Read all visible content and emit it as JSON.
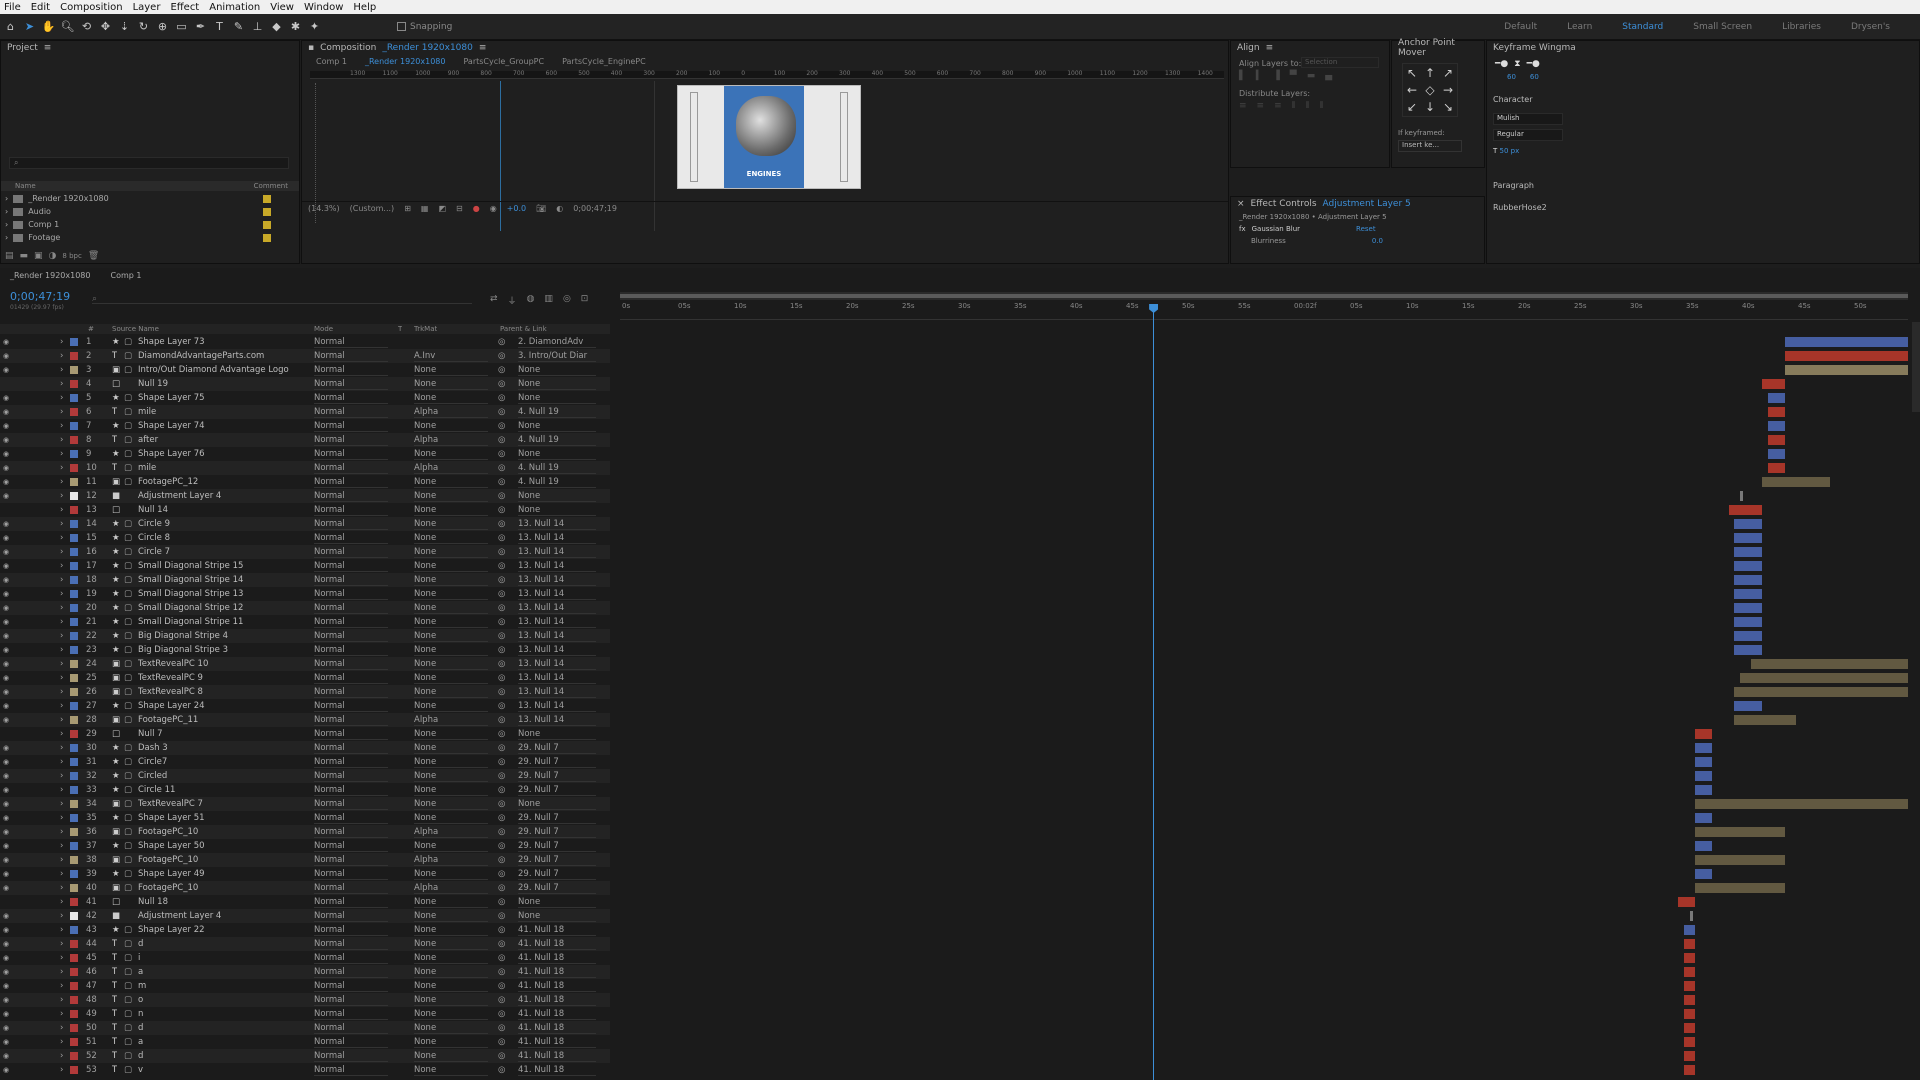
{
  "colors": {
    "accent": "#3d8fd8",
    "red": "#c0392b",
    "blueBar": "#4d6ab8",
    "tanBar": "#9a8c66",
    "tan2": "#6f6448",
    "swatchRed": "#b23a3a",
    "swatchBlue": "#4a6fb5",
    "swatchTan": "#a89a73",
    "swatchWhite": "#e8e8e8",
    "swatchGray": "#8a8a8a"
  },
  "menu": [
    "File",
    "Edit",
    "Composition",
    "Layer",
    "Effect",
    "Animation",
    "View",
    "Window",
    "Help"
  ],
  "toolbar": {
    "snapping": "Snapping",
    "workspaces": [
      "Default",
      "Learn",
      "Standard",
      "Small Screen",
      "Libraries",
      "Drysen's"
    ]
  },
  "project": {
    "title": "Project",
    "col_name": "Name",
    "col_comment": "Comment",
    "items": [
      "_Render 1920x1080",
      "Audio",
      "Comp 1",
      "Footage"
    ],
    "bpc": "8 bpc"
  },
  "composition": {
    "title": "Composition",
    "name": "_Render 1920x1080",
    "tabs": [
      "Comp 1",
      "_Render 1920x1080",
      "PartsCycle_GroupPC",
      "PartsCycle_EnginePC"
    ],
    "zoom": "(14.3%)",
    "res": "(Custom...)",
    "exposure": "+0.0",
    "time": "0;00;47;19",
    "ruler": [
      "1300",
      "1100",
      "1000",
      "900",
      "800",
      "700",
      "600",
      "500",
      "400",
      "300",
      "200",
      "100",
      "0",
      "100",
      "200",
      "300",
      "400",
      "500",
      "600",
      "700",
      "800",
      "900",
      "1000",
      "1100",
      "1200",
      "1300",
      "1400",
      "1500"
    ],
    "preview_text": "ENGINES"
  },
  "align": {
    "title": "Align",
    "align_to": "Align Layers to:",
    "align_to_value": "Selection",
    "distribute": "Distribute Layers:"
  },
  "anchor": {
    "title": "Anchor Point Mover",
    "if_keyframed": "If keyframed:",
    "insert": "Insert ke..."
  },
  "effects": {
    "title": "Effect Controls",
    "layer": "Adjustment Layer 5",
    "path": "_Render 1920x1080 • Adjustment Layer 5",
    "fx": "Gaussian Blur",
    "reset": "Reset",
    "param": "Blurriness",
    "param_val": "0.0"
  },
  "keyframe": {
    "title": "Keyframe Wingma",
    "v1": "60",
    "v2": "60",
    "character": "Character",
    "font": "Mulish",
    "style": "Regular",
    "size": "50 px",
    "paragraph": "Paragraph",
    "rubberhose": "RubberHose2"
  },
  "timeline": {
    "tabs": [
      "_Render 1920x1080",
      "Comp 1"
    ],
    "timecode": "0;00;47;19",
    "frames": "01429 (29.97 fps)",
    "cols": [
      "#",
      "Source Name",
      "Mode",
      "T",
      "TrkMat",
      "Parent & Link"
    ],
    "ticks": [
      "0s",
      "05s",
      "10s",
      "15s",
      "20s",
      "25s",
      "30s",
      "35s",
      "40s",
      "45s",
      "50s",
      "55s",
      "00:02f",
      "05s",
      "10s",
      "15s",
      "20s",
      "25s",
      "30s",
      "35s",
      "40s",
      "45s",
      "50s"
    ],
    "playhead": 47.6,
    "duration": 115
  },
  "layers": [
    {
      "n": "1",
      "name": "Shape Layer 73",
      "t": "star",
      "c": "swatchBlue",
      "mode": "Normal",
      "trk": "",
      "par": "2. DiamondAdv",
      "eye": 1,
      "s": 104,
      "e": 115,
      "bc": "blueBar"
    },
    {
      "n": "2",
      "name": "DiamondAdvantageParts.com",
      "t": "text",
      "c": "swatchRed",
      "mode": "Normal",
      "trk": "A.Inv",
      "par": "3. Intro/Out Diar",
      "eye": 1,
      "s": 104,
      "e": 115,
      "bc": "red"
    },
    {
      "n": "3",
      "name": "Intro/Out Diamond Advantage Logo",
      "t": "comp",
      "c": "swatchTan",
      "mode": "Normal",
      "trk": "None",
      "par": "None",
      "eye": 1,
      "s": 104,
      "e": 115,
      "bc": "tanBar"
    },
    {
      "n": "4",
      "name": "Null 19",
      "t": "null",
      "c": "swatchRed",
      "mode": "Normal",
      "trk": "None",
      "par": "None",
      "eye": 0,
      "s": 102,
      "e": 104,
      "bc": "red"
    },
    {
      "n": "5",
      "name": "Shape Layer 75",
      "t": "star",
      "c": "swatchBlue",
      "mode": "Normal",
      "trk": "None",
      "par": "None",
      "eye": 1,
      "s": 102.5,
      "e": 104,
      "bc": "blueBar"
    },
    {
      "n": "6",
      "name": "mile",
      "t": "text",
      "c": "swatchRed",
      "mode": "Normal",
      "trk": "Alpha",
      "par": "4. Null 19",
      "eye": 1,
      "s": 102.5,
      "e": 104,
      "bc": "red"
    },
    {
      "n": "7",
      "name": "Shape Layer 74",
      "t": "star",
      "c": "swatchBlue",
      "mode": "Normal",
      "trk": "None",
      "par": "None",
      "eye": 1,
      "s": 102.5,
      "e": 104,
      "bc": "blueBar"
    },
    {
      "n": "8",
      "name": "after",
      "t": "text",
      "c": "swatchRed",
      "mode": "Normal",
      "trk": "Alpha",
      "par": "4. Null 19",
      "eye": 1,
      "s": 102.5,
      "e": 104,
      "bc": "red"
    },
    {
      "n": "9",
      "name": "Shape Layer 76",
      "t": "star",
      "c": "swatchBlue",
      "mode": "Normal",
      "trk": "None",
      "par": "None",
      "eye": 1,
      "s": 102.5,
      "e": 104,
      "bc": "blueBar"
    },
    {
      "n": "10",
      "name": "mile",
      "t": "text",
      "c": "swatchRed",
      "mode": "Normal",
      "trk": "Alpha",
      "par": "4. Null 19",
      "eye": 1,
      "s": 102.5,
      "e": 104,
      "bc": "red"
    },
    {
      "n": "11",
      "name": "FootagePC_12",
      "t": "comp",
      "c": "swatchTan",
      "mode": "Normal",
      "trk": "None",
      "par": "4. Null 19",
      "eye": 1,
      "s": 102,
      "e": 108,
      "bc": "tan2"
    },
    {
      "n": "12",
      "name": "Adjustment Layer 4",
      "t": "adj",
      "c": "swatchWhite",
      "mode": "Normal",
      "trk": "None",
      "par": "None",
      "eye": 1,
      "s": 100,
      "e": 100.3,
      "bc": "swatchGray"
    },
    {
      "n": "13",
      "name": "Null 14",
      "t": "null",
      "c": "swatchRed",
      "mode": "Normal",
      "trk": "None",
      "par": "None",
      "eye": 0,
      "s": 99,
      "e": 102,
      "bc": "red"
    },
    {
      "n": "14",
      "name": "Circle 9",
      "t": "star",
      "c": "swatchBlue",
      "mode": "Normal",
      "trk": "None",
      "par": "13. Null 14",
      "eye": 1,
      "s": 99.5,
      "e": 102,
      "bc": "blueBar"
    },
    {
      "n": "15",
      "name": "Circle 8",
      "t": "star",
      "c": "swatchBlue",
      "mode": "Normal",
      "trk": "None",
      "par": "13. Null 14",
      "eye": 1,
      "s": 99.5,
      "e": 102,
      "bc": "blueBar"
    },
    {
      "n": "16",
      "name": "Circle 7",
      "t": "star",
      "c": "swatchBlue",
      "mode": "Normal",
      "trk": "None",
      "par": "13. Null 14",
      "eye": 1,
      "s": 99.5,
      "e": 102,
      "bc": "blueBar"
    },
    {
      "n": "17",
      "name": "Small Diagonal Stripe 15",
      "t": "star",
      "c": "swatchBlue",
      "mode": "Normal",
      "trk": "None",
      "par": "13. Null 14",
      "eye": 1,
      "s": 99.5,
      "e": 102,
      "bc": "blueBar"
    },
    {
      "n": "18",
      "name": "Small Diagonal Stripe 14",
      "t": "star",
      "c": "swatchBlue",
      "mode": "Normal",
      "trk": "None",
      "par": "13. Null 14",
      "eye": 1,
      "s": 99.5,
      "e": 102,
      "bc": "blueBar"
    },
    {
      "n": "19",
      "name": "Small Diagonal Stripe 13",
      "t": "star",
      "c": "swatchBlue",
      "mode": "Normal",
      "trk": "None",
      "par": "13. Null 14",
      "eye": 1,
      "s": 99.5,
      "e": 102,
      "bc": "blueBar"
    },
    {
      "n": "20",
      "name": "Small Diagonal Stripe 12",
      "t": "star",
      "c": "swatchBlue",
      "mode": "Normal",
      "trk": "None",
      "par": "13. Null 14",
      "eye": 1,
      "s": 99.5,
      "e": 102,
      "bc": "blueBar"
    },
    {
      "n": "21",
      "name": "Small Diagonal Stripe 11",
      "t": "star",
      "c": "swatchBlue",
      "mode": "Normal",
      "trk": "None",
      "par": "13. Null 14",
      "eye": 1,
      "s": 99.5,
      "e": 102,
      "bc": "blueBar"
    },
    {
      "n": "22",
      "name": "Big Diagonal Stripe 4",
      "t": "star",
      "c": "swatchBlue",
      "mode": "Normal",
      "trk": "None",
      "par": "13. Null 14",
      "eye": 1,
      "s": 99.5,
      "e": 102,
      "bc": "blueBar"
    },
    {
      "n": "23",
      "name": "Big Diagonal Stripe 3",
      "t": "star",
      "c": "swatchBlue",
      "mode": "Normal",
      "trk": "None",
      "par": "13. Null 14",
      "eye": 1,
      "s": 99.5,
      "e": 102,
      "bc": "blueBar"
    },
    {
      "n": "24",
      "name": "TextRevealPC 10",
      "t": "comp",
      "c": "swatchTan",
      "mode": "Normal",
      "trk": "None",
      "par": "13. Null 14",
      "eye": 1,
      "s": 101,
      "e": 115,
      "bc": "tan2"
    },
    {
      "n": "25",
      "name": "TextRevealPC 9",
      "t": "comp",
      "c": "swatchTan",
      "mode": "Normal",
      "trk": "None",
      "par": "13. Null 14",
      "eye": 1,
      "s": 100,
      "e": 115,
      "bc": "tan2"
    },
    {
      "n": "26",
      "name": "TextRevealPC 8",
      "t": "comp",
      "c": "swatchTan",
      "mode": "Normal",
      "trk": "None",
      "par": "13. Null 14",
      "eye": 1,
      "s": 99.5,
      "e": 115,
      "bc": "tan2"
    },
    {
      "n": "27",
      "name": "Shape Layer 24",
      "t": "star",
      "c": "swatchBlue",
      "mode": "Normal",
      "trk": "None",
      "par": "13. Null 14",
      "eye": 1,
      "s": 99.5,
      "e": 102,
      "bc": "blueBar"
    },
    {
      "n": "28",
      "name": "FootagePC_11",
      "t": "comp",
      "c": "swatchTan",
      "mode": "Normal",
      "trk": "Alpha",
      "par": "13. Null 14",
      "eye": 1,
      "s": 99.5,
      "e": 105,
      "bc": "tan2"
    },
    {
      "n": "29",
      "name": "Null 7",
      "t": "null",
      "c": "swatchRed",
      "mode": "Normal",
      "trk": "None",
      "par": "None",
      "eye": 0,
      "s": 96,
      "e": 97.5,
      "bc": "red"
    },
    {
      "n": "30",
      "name": "Dash 3",
      "t": "star",
      "c": "swatchBlue",
      "mode": "Normal",
      "trk": "None",
      "par": "29. Null 7",
      "eye": 1,
      "s": 96,
      "e": 97.5,
      "bc": "blueBar"
    },
    {
      "n": "31",
      "name": "Circle7",
      "t": "star",
      "c": "swatchBlue",
      "mode": "Normal",
      "trk": "None",
      "par": "29. Null 7",
      "eye": 1,
      "s": 96,
      "e": 97.5,
      "bc": "blueBar"
    },
    {
      "n": "32",
      "name": "Circled",
      "t": "star",
      "c": "swatchBlue",
      "mode": "Normal",
      "trk": "None",
      "par": "29. Null 7",
      "eye": 1,
      "s": 96,
      "e": 97.5,
      "bc": "blueBar"
    },
    {
      "n": "33",
      "name": "Circle 11",
      "t": "star",
      "c": "swatchBlue",
      "mode": "Normal",
      "trk": "None",
      "par": "29. Null 7",
      "eye": 1,
      "s": 96,
      "e": 97.5,
      "bc": "blueBar"
    },
    {
      "n": "34",
      "name": "TextRevealPC 7",
      "t": "comp",
      "c": "swatchTan",
      "mode": "Normal",
      "trk": "None",
      "par": "None",
      "eye": 1,
      "s": 96,
      "e": 115,
      "bc": "tan2"
    },
    {
      "n": "35",
      "name": "Shape Layer 51",
      "t": "star",
      "c": "swatchBlue",
      "mode": "Normal",
      "trk": "None",
      "par": "29. Null 7",
      "eye": 1,
      "s": 96,
      "e": 97.5,
      "bc": "blueBar"
    },
    {
      "n": "36",
      "name": "FootagePC_10",
      "t": "comp",
      "c": "swatchTan",
      "mode": "Normal",
      "trk": "Alpha",
      "par": "29. Null 7",
      "eye": 1,
      "s": 96,
      "e": 104,
      "bc": "tan2"
    },
    {
      "n": "37",
      "name": "Shape Layer 50",
      "t": "star",
      "c": "swatchBlue",
      "mode": "Normal",
      "trk": "None",
      "par": "29. Null 7",
      "eye": 1,
      "s": 96,
      "e": 97.5,
      "bc": "blueBar"
    },
    {
      "n": "38",
      "name": "FootagePC_10",
      "t": "comp",
      "c": "swatchTan",
      "mode": "Normal",
      "trk": "Alpha",
      "par": "29. Null 7",
      "eye": 1,
      "s": 96,
      "e": 104,
      "bc": "tan2"
    },
    {
      "n": "39",
      "name": "Shape Layer 49",
      "t": "star",
      "c": "swatchBlue",
      "mode": "Normal",
      "trk": "None",
      "par": "29. Null 7",
      "eye": 1,
      "s": 96,
      "e": 97.5,
      "bc": "blueBar"
    },
    {
      "n": "40",
      "name": "FootagePC_10",
      "t": "comp",
      "c": "swatchTan",
      "mode": "Normal",
      "trk": "Alpha",
      "par": "29. Null 7",
      "eye": 1,
      "s": 96,
      "e": 104,
      "bc": "tan2"
    },
    {
      "n": "41",
      "name": "Null 18",
      "t": "null",
      "c": "swatchRed",
      "mode": "Normal",
      "trk": "None",
      "par": "None",
      "eye": 0,
      "s": 94.5,
      "e": 96,
      "bc": "red"
    },
    {
      "n": "42",
      "name": "Adjustment Layer 4",
      "t": "adj",
      "c": "swatchWhite",
      "mode": "Normal",
      "trk": "None",
      "par": "None",
      "eye": 1,
      "s": 95.5,
      "e": 95.8,
      "bc": "swatchGray"
    },
    {
      "n": "43",
      "name": "Shape Layer 22",
      "t": "star",
      "c": "swatchBlue",
      "mode": "Normal",
      "trk": "None",
      "par": "41. Null 18",
      "eye": 1,
      "s": 95,
      "e": 96,
      "bc": "blueBar"
    },
    {
      "n": "44",
      "name": "d",
      "t": "text",
      "c": "swatchRed",
      "mode": "Normal",
      "trk": "None",
      "par": "41. Null 18",
      "eye": 1,
      "s": 95,
      "e": 96,
      "bc": "red"
    },
    {
      "n": "45",
      "name": "i",
      "t": "text",
      "c": "swatchRed",
      "mode": "Normal",
      "trk": "None",
      "par": "41. Null 18",
      "eye": 1,
      "s": 95,
      "e": 96,
      "bc": "red"
    },
    {
      "n": "46",
      "name": "a",
      "t": "text",
      "c": "swatchRed",
      "mode": "Normal",
      "trk": "None",
      "par": "41. Null 18",
      "eye": 1,
      "s": 95,
      "e": 96,
      "bc": "red"
    },
    {
      "n": "47",
      "name": "m",
      "t": "text",
      "c": "swatchRed",
      "mode": "Normal",
      "trk": "None",
      "par": "41. Null 18",
      "eye": 1,
      "s": 95,
      "e": 96,
      "bc": "red"
    },
    {
      "n": "48",
      "name": "o",
      "t": "text",
      "c": "swatchRed",
      "mode": "Normal",
      "trk": "None",
      "par": "41. Null 18",
      "eye": 1,
      "s": 95,
      "e": 96,
      "bc": "red"
    },
    {
      "n": "49",
      "name": "n",
      "t": "text",
      "c": "swatchRed",
      "mode": "Normal",
      "trk": "None",
      "par": "41. Null 18",
      "eye": 1,
      "s": 95,
      "e": 96,
      "bc": "red"
    },
    {
      "n": "50",
      "name": "d",
      "t": "text",
      "c": "swatchRed",
      "mode": "Normal",
      "trk": "None",
      "par": "41. Null 18",
      "eye": 1,
      "s": 95,
      "e": 96,
      "bc": "red"
    },
    {
      "n": "51",
      "name": "a",
      "t": "text",
      "c": "swatchRed",
      "mode": "Normal",
      "trk": "None",
      "par": "41. Null 18",
      "eye": 1,
      "s": 95,
      "e": 96,
      "bc": "red"
    },
    {
      "n": "52",
      "name": "d",
      "t": "text",
      "c": "swatchRed",
      "mode": "Normal",
      "trk": "None",
      "par": "41. Null 18",
      "eye": 1,
      "s": 95,
      "e": 96,
      "bc": "red"
    },
    {
      "n": "53",
      "name": "v",
      "t": "text",
      "c": "swatchRed",
      "mode": "Normal",
      "trk": "None",
      "par": "41. Null 18",
      "eye": 1,
      "s": 95,
      "e": 96,
      "bc": "red"
    }
  ]
}
